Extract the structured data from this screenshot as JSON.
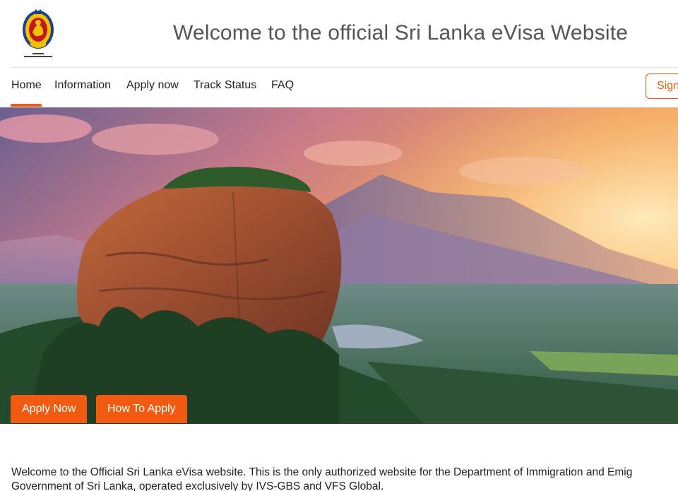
{
  "header": {
    "title": "Welcome to the official Sri Lanka eVisa Website",
    "logo_icon": "sri-lanka-immigration-emblem"
  },
  "nav": {
    "items": [
      {
        "label": "Home",
        "active": true
      },
      {
        "label": "Information",
        "active": false
      },
      {
        "label": "Apply now",
        "active": false
      },
      {
        "label": "Track Status",
        "active": false
      },
      {
        "label": "FAQ",
        "active": false
      }
    ],
    "signin_label": "Sign"
  },
  "hero": {
    "image": "sigiriya-rock-fortress-sunset",
    "apply_now_label": "Apply Now",
    "how_to_apply_label": "How To Apply"
  },
  "intro": {
    "line1": "Welcome to the Official Sri Lanka eVisa website. This is the only authorized website for the Department of Immigration and Emig",
    "line2": "Government of Sri Lanka, operated exclusively by IVS-GBS and VFS Global."
  },
  "colors": {
    "accent": "#f25a11",
    "title": "#555555",
    "text": "#222222"
  }
}
